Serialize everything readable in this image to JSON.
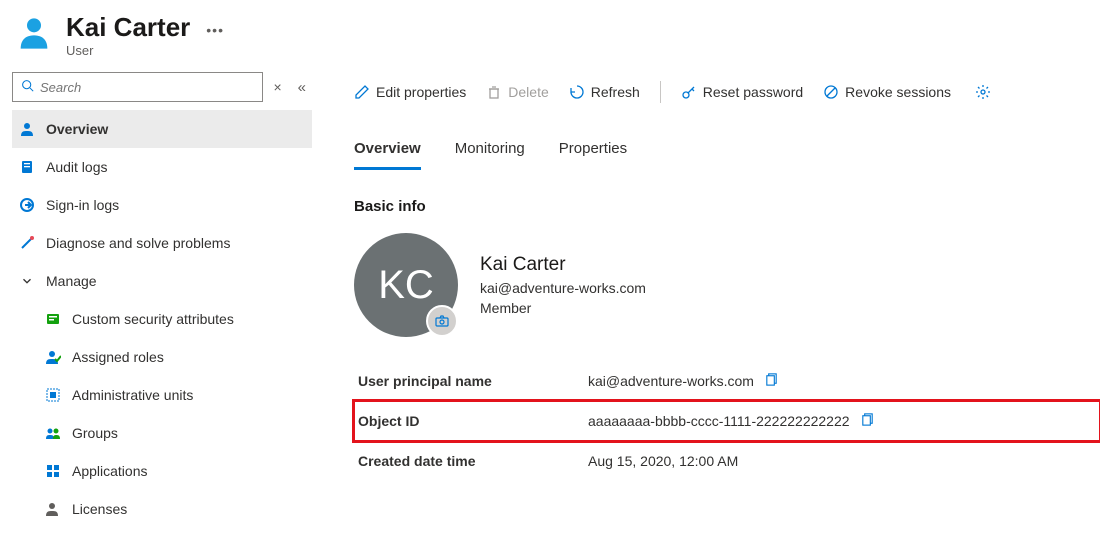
{
  "header": {
    "title": "Kai Carter",
    "subtitle": "User"
  },
  "search": {
    "placeholder": "Search"
  },
  "sidebar": {
    "items": [
      {
        "label": "Overview",
        "active": true
      },
      {
        "label": "Audit logs"
      },
      {
        "label": "Sign-in logs"
      },
      {
        "label": "Diagnose and solve problems"
      }
    ],
    "manage_label": "Manage",
    "manage_items": [
      {
        "label": "Custom security attributes"
      },
      {
        "label": "Assigned roles"
      },
      {
        "label": "Administrative units"
      },
      {
        "label": "Groups"
      },
      {
        "label": "Applications"
      },
      {
        "label": "Licenses"
      }
    ]
  },
  "toolbar": {
    "edit": "Edit properties",
    "delete": "Delete",
    "refresh": "Refresh",
    "reset": "Reset password",
    "revoke": "Revoke sessions"
  },
  "tabs": {
    "overview": "Overview",
    "monitoring": "Monitoring",
    "properties": "Properties"
  },
  "basic_info": {
    "section_title": "Basic info",
    "initials": "KC",
    "name": "Kai Carter",
    "email": "kai@adventure-works.com",
    "member_type": "Member",
    "rows": {
      "upn_label": "User principal name",
      "upn_value": "kai@adventure-works.com",
      "objectid_label": "Object ID",
      "objectid_value": "aaaaaaaa-bbbb-cccc-1111-222222222222",
      "created_label": "Created date time",
      "created_value": "Aug 15, 2020, 12:00 AM"
    }
  }
}
